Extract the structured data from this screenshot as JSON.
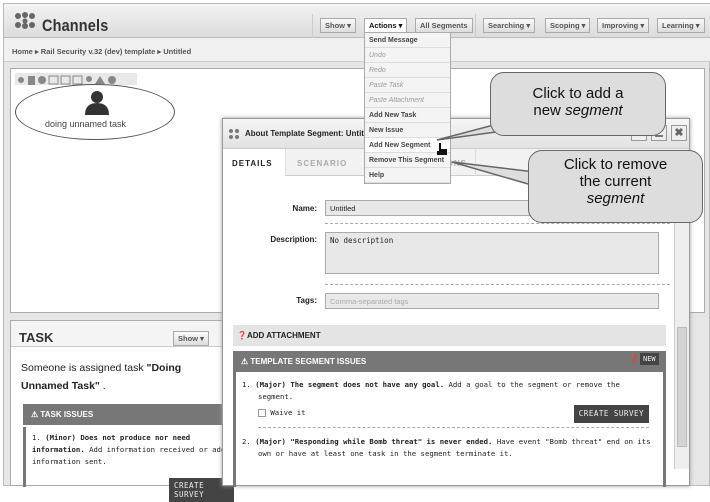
{
  "app": {
    "title": "Channels"
  },
  "toolbar": {
    "show": "Show ▾",
    "actions": "Actions ▾",
    "all_segments": "All Segments",
    "searching": "Searching ▾",
    "scoping": "Scoping ▾",
    "improving": "Improving ▾",
    "learning": "Learning ▾"
  },
  "breadcrumb": [
    "Home",
    "Rail Security v.32 (dev) template",
    "Untitled"
  ],
  "breadcrumb_sep": "▸",
  "plan": {
    "node_label": "doing unnamed task"
  },
  "actions_menu": [
    {
      "label": "Send Message",
      "disabled": false
    },
    {
      "label": "Undo",
      "disabled": true
    },
    {
      "label": "Redo",
      "disabled": true
    },
    {
      "label": "Paste Task",
      "disabled": true
    },
    {
      "label": "Paste Attachment",
      "disabled": true
    },
    {
      "label": "Add New Task",
      "disabled": false
    },
    {
      "label": "New Issue",
      "disabled": false
    },
    {
      "label": "Add New Segment",
      "disabled": false
    },
    {
      "label": "Remove This Segment",
      "disabled": false
    },
    {
      "label": "Help",
      "disabled": false
    }
  ],
  "callouts": {
    "add": {
      "line1": "Click to add a",
      "line2a": "new ",
      "line2b": "segment"
    },
    "remove": {
      "line1": "Click to remove",
      "line2": "the current",
      "line3": "segment"
    }
  },
  "dialog": {
    "title": "About Template Segment: Untitled",
    "tabs": [
      "DETAILS",
      "SCENARIO",
      "ORGANIZATIONS"
    ],
    "name_label": "Name:",
    "name_value": "Untitled",
    "description_label": "Description:",
    "description_value": "No description",
    "tags_label": "Tags:",
    "tags_placeholder": "Comma-separated tags",
    "add_attachment": "ADD ATTACHMENT",
    "issues_title": "TEMPLATE SEGMENT ISSUES",
    "new_label": "NEW",
    "issues": [
      {
        "num": "1.",
        "bold": "(Major) The segment does not have any goal.",
        "text": " Add a goal to the segment or remove the segment.",
        "waive": "Waive it",
        "survey": "CREATE SURVEY"
      },
      {
        "num": "2.",
        "bold": "(Major) \"Responding while Bomb threat\" is never ended.",
        "text": " Have event \"Bomb threat\" end on its own or have at least one task in the segment terminate it."
      }
    ]
  },
  "task_panel": {
    "title": "TASK",
    "show": "Show ▾",
    "summary_prefix": "Someone is assigned task ",
    "summary_bold": "\"Doing Unnamed Task\"",
    "summary_suffix": " .",
    "issues_title": "TASK ISSUES",
    "issues": [
      {
        "num": "1.",
        "bold": "(Minor) Does not produce nor need information.",
        "text": " Add information received or add information sent.",
        "survey": "CREATE SURVEY"
      }
    ]
  }
}
